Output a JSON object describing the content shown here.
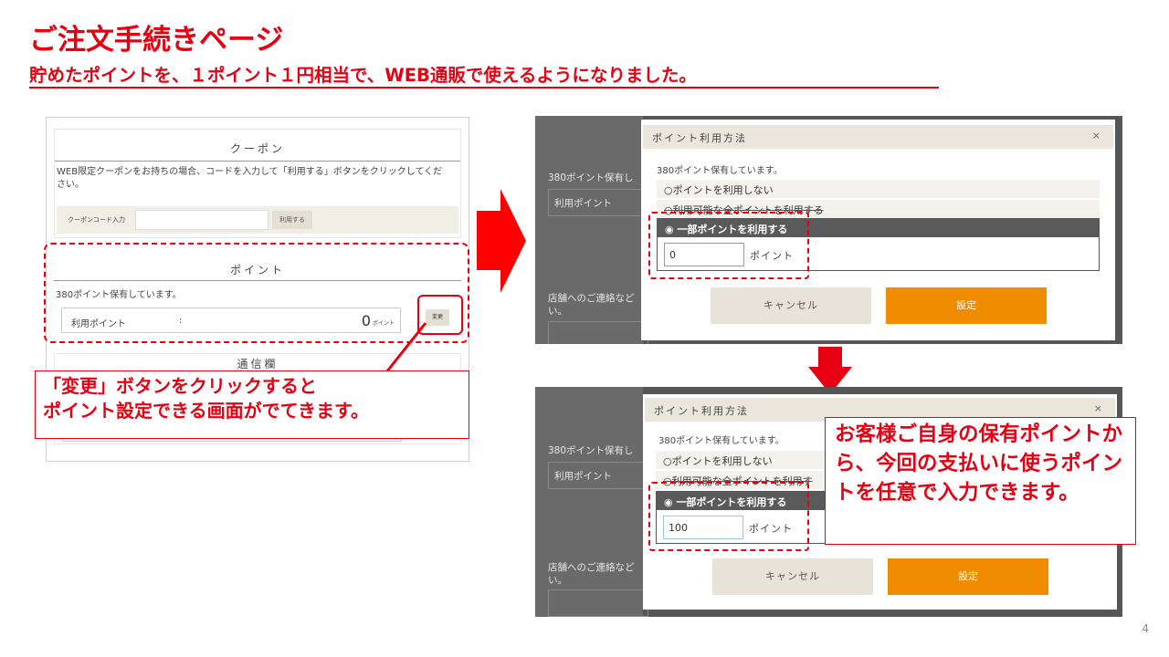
{
  "slide": {
    "title": "ご注文手続きページ",
    "subtitle": "貯めたポイントを、１ポイント１円相当で、WEB通販で使えるようになりました。",
    "page_number": "4"
  },
  "left_panel": {
    "coupon": {
      "heading": "クーポン",
      "description_line1": "WEB限定クーポンをお持ちの場合、コードを入力して「利用する」ボタンをクリックしてくだ",
      "description_line2": "さい。",
      "input_label": "クーポンコード入力",
      "input_value": "",
      "apply_button": "利用する"
    },
    "points": {
      "heading": "ポイント",
      "held_text": "380ポイント保有しています。",
      "field_label": "利用ポイント",
      "field_colon": ":",
      "field_value": "0",
      "field_unit": "ポイント",
      "change_button": "変更"
    },
    "next_heading": "通信欄"
  },
  "callouts": {
    "change_line1": "「変更」ボタンをクリックすると",
    "change_line2": "ポイント設定できる画面がでてきます。",
    "input_text": "お客様ご自身の保有ポイントから、今回の支払いに使うポイントを任意で入力できます。"
  },
  "modal_before": {
    "background_held": "380ポイント保有し",
    "background_field": "利用ポイント",
    "background_contact_1": "店舗へのご連絡など",
    "background_contact_2": "い。",
    "title": "ポイント利用方法",
    "close": "×",
    "held_text": "380ポイント保有しています。",
    "option_none": "ポイントを利用しない",
    "option_all": "利用可能な全ポイントを利用する",
    "option_partial": "一部ポイントを利用する",
    "input_value": "0",
    "input_unit": "ポイント",
    "cancel_button": "キャンセル",
    "set_button": "設定"
  },
  "modal_after": {
    "background_held": "380ポイント保有し",
    "background_field": "利用ポイント",
    "background_contact_1": "店舗へのご連絡など",
    "background_contact_2": "い。",
    "title": "ポイント利用方法",
    "close": "×",
    "held_text": "380ポイント保有しています。",
    "option_none": "ポイントを利用しない",
    "option_all": "利用可能な全ポイントを利用す",
    "option_partial": "一部ポイントを利用する",
    "input_value": "100",
    "input_unit": "ポイント",
    "cancel_button": "キャンセル",
    "set_button": "設定"
  },
  "colors": {
    "accent_red": "#e60012",
    "set_orange": "#f08c00",
    "beige": "#eae6dc"
  },
  "icons": [
    "radio-icon",
    "arrow-right-icon",
    "arrow-down-icon"
  ]
}
